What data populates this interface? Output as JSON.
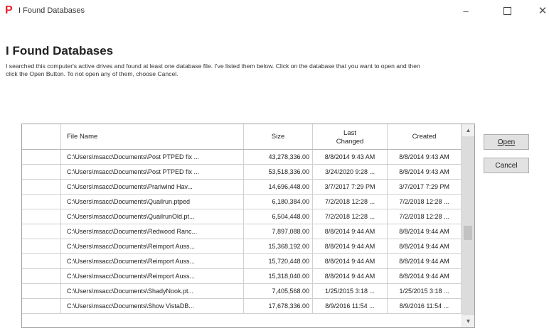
{
  "window": {
    "title": "I Found Databases",
    "controls": {
      "minimize": "–",
      "close": "✕"
    }
  },
  "app_icon": "P",
  "heading": "I Found Databases",
  "description": "I searched this computer's active drives and found at least one database file. I've listed them below. Click on the database that you want to open and then click the Open Button. To not open any of them, choose Cancel.",
  "table": {
    "headers": {
      "file_name": "File Name",
      "size": "Size",
      "last_changed_1": "Last",
      "last_changed_2": "Changed",
      "created": "Created"
    },
    "rows": [
      {
        "name": "C:\\Users\\msacc\\Documents\\Post PTPED fix ...",
        "size": "43,278,336.00",
        "changed": "8/8/2014 9:43 AM",
        "created": "8/8/2014 9:43 AM"
      },
      {
        "name": "C:\\Users\\msacc\\Documents\\Post PTPED fix ...",
        "size": "53,518,336.00",
        "changed": "3/24/2020 9:28 ...",
        "created": "8/8/2014 9:43 AM"
      },
      {
        "name": "C:\\Users\\msacc\\Documents\\Prariwind Hav...",
        "size": "14,696,448.00",
        "changed": "3/7/2017 7:29 PM",
        "created": "3/7/2017 7:29 PM"
      },
      {
        "name": "C:\\Users\\msacc\\Documents\\Quailrun.ptped",
        "size": "6,180,384.00",
        "changed": "7/2/2018 12:28 ...",
        "created": "7/2/2018 12:28 ..."
      },
      {
        "name": "C:\\Users\\msacc\\Documents\\QuailrunOld.pt...",
        "size": "6,504,448.00",
        "changed": "7/2/2018 12:28 ...",
        "created": "7/2/2018 12:28 ..."
      },
      {
        "name": "C:\\Users\\msacc\\Documents\\Redwood Ranc...",
        "size": "7,897,088.00",
        "changed": "8/8/2014 9:44 AM",
        "created": "8/8/2014 9:44 AM"
      },
      {
        "name": "C:\\Users\\msacc\\Documents\\Reimport Auss...",
        "size": "15,368,192.00",
        "changed": "8/8/2014 9:44 AM",
        "created": "8/8/2014 9:44 AM"
      },
      {
        "name": "C:\\Users\\msacc\\Documents\\Reimport Auss...",
        "size": "15,720,448.00",
        "changed": "8/8/2014 9:44 AM",
        "created": "8/8/2014 9:44 AM"
      },
      {
        "name": "C:\\Users\\msacc\\Documents\\Reimport Auss...",
        "size": "15,318,040.00",
        "changed": "8/8/2014 9:44 AM",
        "created": "8/8/2014 9:44 AM"
      },
      {
        "name": "C:\\Users\\msacc\\Documents\\ShadyNook.pt...",
        "size": "7,405,568.00",
        "changed": "1/25/2015 3:18 ...",
        "created": "1/25/2015 3:18 ..."
      },
      {
        "name": "C:\\Users\\msacc\\Documents\\Show VistaDB...",
        "size": "17,678,336.00",
        "changed": "8/9/2016 11:54 ...",
        "created": "8/9/2016 11:54 ..."
      }
    ]
  },
  "buttons": {
    "open": "Open",
    "cancel": "Cancel"
  },
  "icons": {
    "minimize": "minimize-icon",
    "maximize": "maximize-icon",
    "close": "close-icon",
    "scroll_up": "chevron-up-icon",
    "scroll_down": "chevron-down-icon"
  },
  "colors": {
    "app_icon": "#e8222b",
    "button_bg": "#e1e1e1",
    "grid_border": "#a0a0a0"
  }
}
